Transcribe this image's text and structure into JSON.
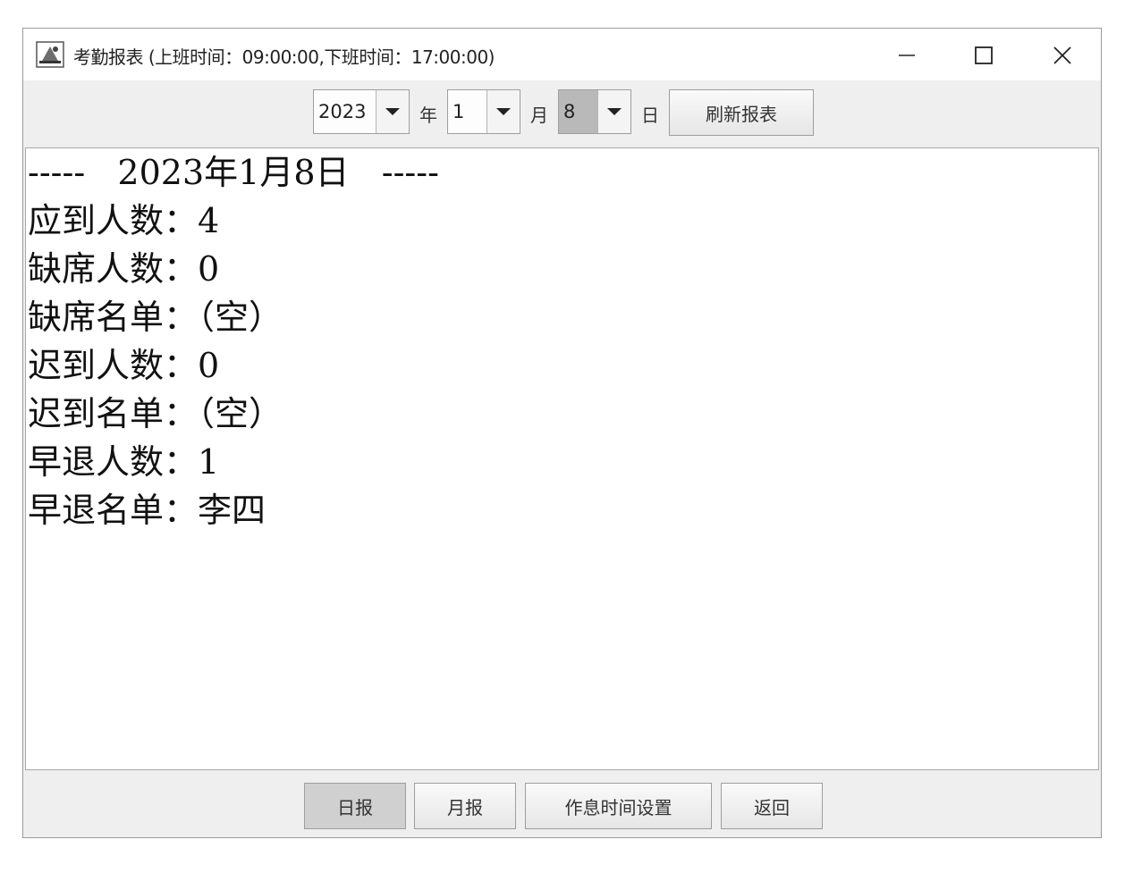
{
  "window": {
    "title": "考勤报表 (上班时间：09:00:00,下班时间：17:00:00)",
    "minimize_icon": "minimize-icon",
    "maximize_icon": "maximize-icon",
    "close_icon": "close-icon"
  },
  "toolbar": {
    "year_value": "2023",
    "year_unit": "年",
    "month_value": "1",
    "month_unit": "月",
    "day_value": "8",
    "day_unit": "日",
    "refresh_label": "刷新报表"
  },
  "report": {
    "header": "-----   2023年1月8日   -----",
    "lines": [
      "应到人数：4",
      "缺席人数：0",
      "缺席名单：（空）",
      "迟到人数：0",
      "迟到名单：（空）",
      "早退人数：1",
      "早退名单：李四"
    ]
  },
  "footer": {
    "daily_label": "日报",
    "monthly_label": "月报",
    "schedule_label": "作息时间设置",
    "back_label": "返回"
  },
  "colors": {
    "window_bg": "#efefef",
    "content_bg": "#ffffff",
    "border": "#9e9e9e",
    "selected_bg": "#b9b9b9"
  }
}
